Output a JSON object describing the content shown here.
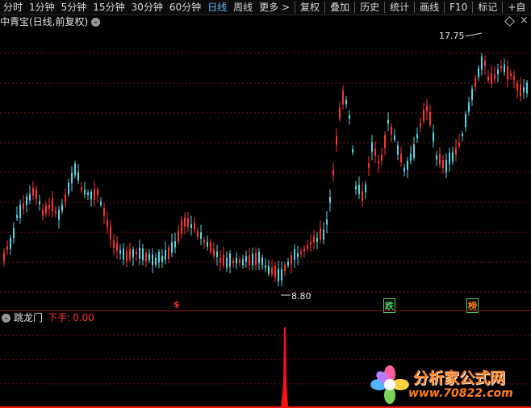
{
  "toolbar": {
    "period_items": [
      "分时",
      "1分钟",
      "5分钟",
      "15分钟",
      "30分钟",
      "60分钟",
      "日线",
      "周线",
      "更多 >"
    ],
    "active_item": "日线",
    "tool_items": [
      "复权",
      "叠加",
      "历史",
      "统计",
      "画线",
      "F10",
      "标记",
      "+自"
    ]
  },
  "header": {
    "title": "中青宝(日线,前复权)",
    "dropdown_icon": "chevron-down-icon"
  },
  "price_panel": {
    "high_label": "17.75",
    "low_label": "8.80",
    "signal_labels": [
      {
        "text": "$",
        "color": "#ff3030"
      },
      {
        "text": "跌",
        "color": "#4ad36a"
      },
      {
        "text": "榜",
        "color": "#ff7f1f"
      }
    ]
  },
  "indicator_panel": {
    "name": "跳龙门",
    "signal_label": "下手:",
    "signal_value": "0.00"
  },
  "watermark": {
    "text": "分析家公式网",
    "url": "www.70822.com"
  },
  "colors": {
    "up": "#ff3232",
    "down": "#54d6e6",
    "grid": "#7a1515",
    "signal": "#ff1010"
  },
  "chart_data": {
    "type": "candlestick",
    "title": "中青宝(日线,前复权)",
    "annotated_high": 17.75,
    "annotated_low": 8.8,
    "indicator": {
      "name": "跳龙门",
      "series": "下手",
      "value": 0.0,
      "spike_value": 1.0
    }
  }
}
